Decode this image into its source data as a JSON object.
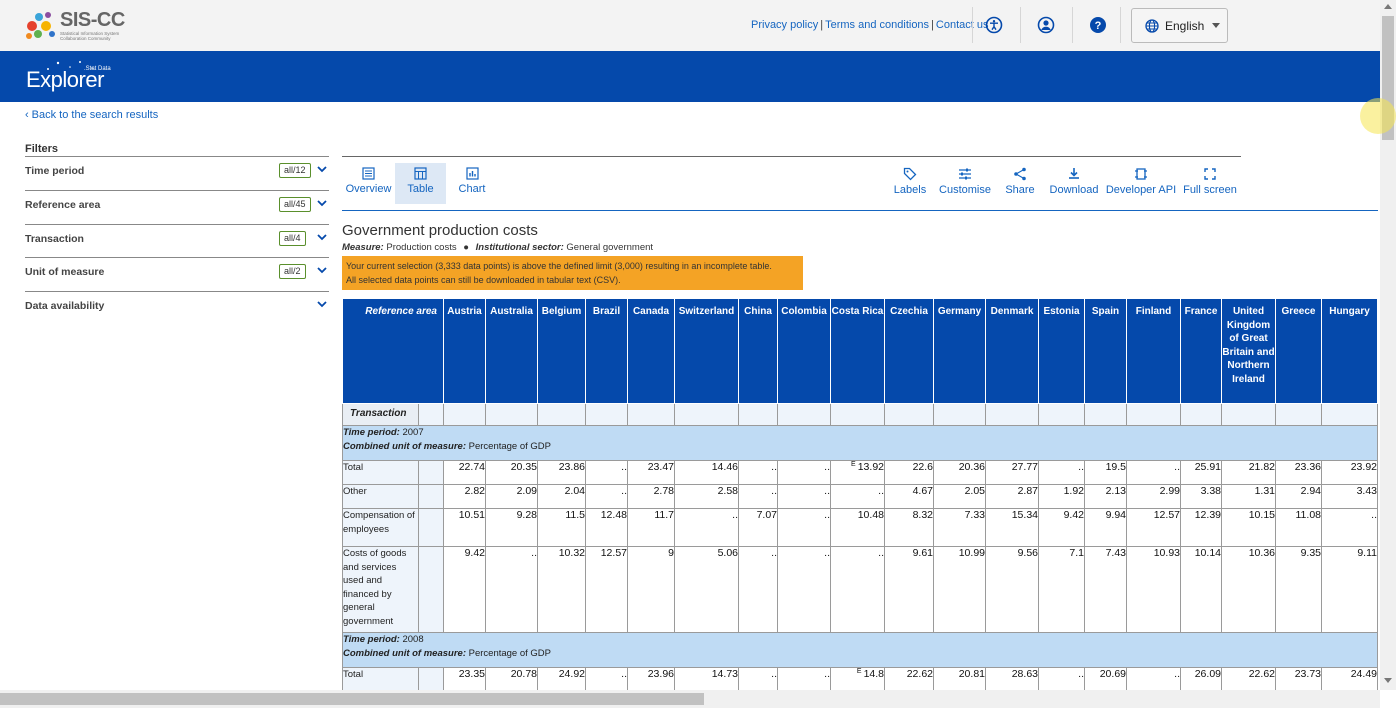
{
  "header": {
    "logo_text": "SIS-CC",
    "logo_subtitle": "Statistical Information System Collaboration Community",
    "links": [
      "Privacy policy",
      "Terms and conditions",
      "Contact us"
    ],
    "icons": [
      "accessibility-icon",
      "account-icon",
      "help-icon"
    ],
    "language": "English"
  },
  "banner": {
    "title": "Explorer",
    "superscript": ".Stat Data"
  },
  "back_link": "Back to the search results",
  "filters": {
    "title": "Filters",
    "items": [
      {
        "label": "Time period",
        "badge": "all/12"
      },
      {
        "label": "Reference area",
        "badge": "all/45"
      },
      {
        "label": "Transaction",
        "badge": "all/4"
      },
      {
        "label": "Unit of measure",
        "badge": "all/2"
      },
      {
        "label": "Data availability",
        "badge": ""
      }
    ]
  },
  "view_tabs": {
    "overview": "Overview",
    "table": "Table",
    "chart": "Chart",
    "active": "Table"
  },
  "actions": {
    "labels": "Labels",
    "customise": "Customise",
    "share": "Share",
    "download": "Download",
    "developer_api": "Developer API",
    "full_screen": "Full screen"
  },
  "dataset": {
    "title": "Government production costs",
    "measure_label": "Measure:",
    "measure_value": "Production costs",
    "sector_label": "Institutional sector:",
    "sector_value": "General government",
    "warning_line1": "Your current selection (3,333 data points) is above the defined limit (3,000) resulting in an incomplete table.",
    "warning_line2": "All selected data points can still be downloaded in tabular text (CSV)."
  },
  "table": {
    "ref_header": "Reference area",
    "transaction_header": "Transaction",
    "columns": [
      "Austria",
      "Australia",
      "Belgium",
      "Brazil",
      "Canada",
      "Switzerland",
      "China",
      "Colombia",
      "Costa Rica",
      "Czechia",
      "Germany",
      "Denmark",
      "Estonia",
      "Spain",
      "Finland",
      "France",
      "United Kingdom of Great Britain and Northern Ireland",
      "Greece",
      "Hungary"
    ],
    "sections": [
      {
        "time_label": "Time period:",
        "time_value": "2007",
        "unit_label": "Combined unit of measure:",
        "unit_value": "Percentage of GDP",
        "rows": [
          {
            "label": "Total",
            "values": [
              "22.74",
              "20.35",
              "23.86",
              "..",
              "23.47",
              "14.46",
              "..",
              "..",
              "13.92",
              "22.6",
              "20.36",
              "27.77",
              "..",
              "19.5",
              "..",
              "25.91",
              "21.82",
              "23.36",
              "23.92"
            ]
          },
          {
            "label": "Other",
            "values": [
              "2.82",
              "2.09",
              "2.04",
              "..",
              "2.78",
              "2.58",
              "..",
              "..",
              "..",
              "4.67",
              "2.05",
              "2.87",
              "1.92",
              "2.13",
              "2.99",
              "3.38",
              "1.31",
              "2.94",
              "3.43"
            ]
          },
          {
            "label": "Compensation of employees",
            "values": [
              "10.51",
              "9.28",
              "11.5",
              "12.48",
              "11.7",
              "..",
              "7.07",
              "..",
              "10.48",
              "8.32",
              "7.33",
              "15.34",
              "9.42",
              "9.94",
              "12.57",
              "12.39",
              "10.15",
              "11.08",
              ".."
            ]
          },
          {
            "label": "Costs of goods and services used and financed by general government",
            "values": [
              "9.42",
              "..",
              "10.32",
              "12.57",
              "9",
              "5.06",
              "..",
              "..",
              "..",
              "9.61",
              "10.99",
              "9.56",
              "7.1",
              "7.43",
              "10.93",
              "10.14",
              "10.36",
              "9.35",
              "9.11"
            ]
          }
        ]
      },
      {
        "time_label": "Time period:",
        "time_value": "2008",
        "unit_label": "Combined unit of measure:",
        "unit_value": "Percentage of GDP",
        "rows": [
          {
            "label": "Total",
            "values": [
              "23.35",
              "20.78",
              "24.92",
              "..",
              "23.96",
              "14.73",
              "..",
              "..",
              "14.8",
              "22.62",
              "20.81",
              "28.63",
              "..",
              "20.69",
              "..",
              "26.09",
              "22.62",
              "23.73",
              "24.49"
            ]
          }
        ]
      }
    ],
    "flag_symbol": "E"
  },
  "colors": {
    "brand_blue": "#0549ab",
    "link_blue": "#1565c0",
    "warning": "#f4a325",
    "section_bg": "#bfdbf4"
  }
}
